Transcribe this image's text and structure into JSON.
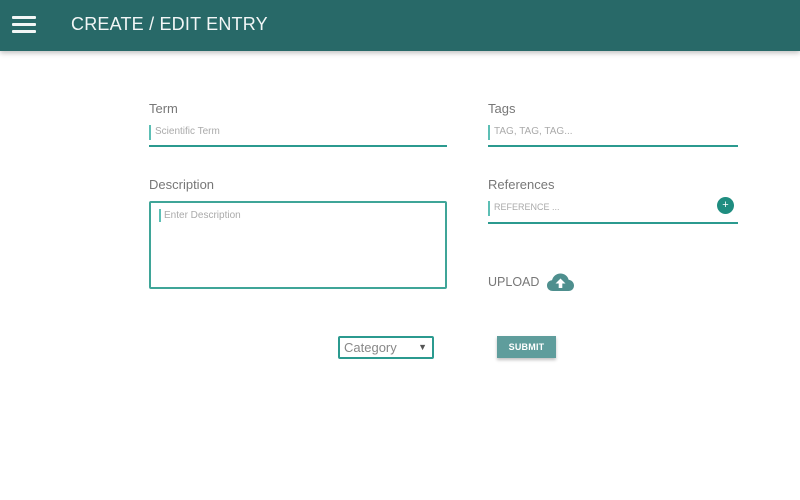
{
  "header": {
    "title": "CREATE / EDIT ENTRY",
    "menu_icon": "hamburger-menu-icon",
    "background_color": "#286968"
  },
  "form": {
    "term": {
      "label": "Term",
      "value": "",
      "placeholder": "Scientific Term"
    },
    "tags": {
      "label": "Tags",
      "value": "",
      "placeholder": "TAG, TAG, TAG..."
    },
    "description": {
      "label": "Description",
      "value": "",
      "placeholder": "Enter Description"
    },
    "references": {
      "label": "References",
      "value": "",
      "placeholder": "REFERENCE ...",
      "add_icon": "plus-icon",
      "add_label": "+"
    },
    "upload": {
      "label": "UPLOAD",
      "icon": "cloud-upload-icon"
    },
    "category": {
      "selected": "Category",
      "arrow": "▼"
    },
    "submit_label": "SUBMIT"
  },
  "colors": {
    "accent": "#2b9a8f",
    "submit": "#5f9d9c"
  }
}
